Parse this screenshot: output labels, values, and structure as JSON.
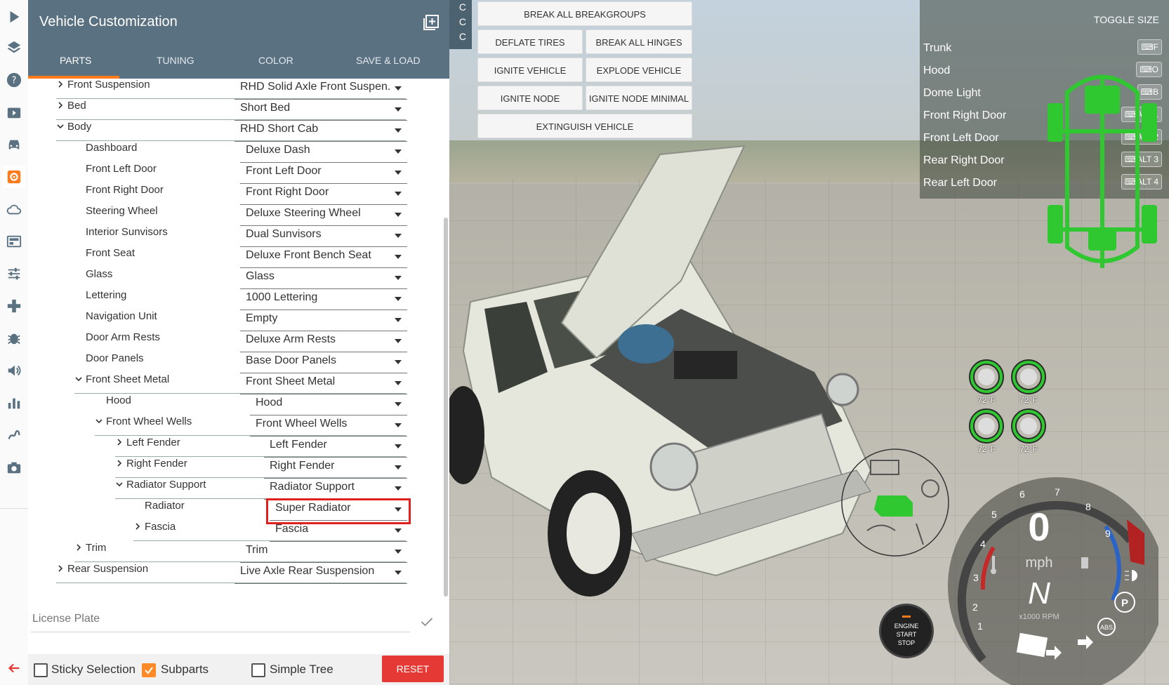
{
  "panel": {
    "title": "Vehicle Customization",
    "tabs": [
      "PARTS",
      "TUNING",
      "COLOR",
      "SAVE & LOAD"
    ],
    "active_tab": "PARTS",
    "tree": [
      {
        "label": "Front Suspension",
        "value": "RHD Solid Axle Front Suspen...",
        "depth": 0,
        "expander": "collapsed"
      },
      {
        "label": "Bed",
        "value": "Short Bed",
        "depth": 0,
        "expander": "collapsed"
      },
      {
        "label": "Body",
        "value": "RHD Short Cab",
        "depth": 0,
        "expander": "expanded"
      },
      {
        "label": "Dashboard",
        "value": "Deluxe Dash",
        "depth": 1,
        "expander": "none"
      },
      {
        "label": "Front Left Door",
        "value": "Front Left Door",
        "depth": 1,
        "expander": "none"
      },
      {
        "label": "Front Right Door",
        "value": "Front Right Door",
        "depth": 1,
        "expander": "none"
      },
      {
        "label": "Steering Wheel",
        "value": "Deluxe Steering Wheel",
        "depth": 1,
        "expander": "none"
      },
      {
        "label": "Interior Sunvisors",
        "value": "Dual Sunvisors",
        "depth": 1,
        "expander": "none"
      },
      {
        "label": "Front Seat",
        "value": "Deluxe Front Bench Seat",
        "depth": 1,
        "expander": "none"
      },
      {
        "label": "Glass",
        "value": "Glass",
        "depth": 1,
        "expander": "none"
      },
      {
        "label": "Lettering",
        "value": "1000 Lettering",
        "depth": 1,
        "expander": "none"
      },
      {
        "label": "Navigation Unit",
        "value": "Empty",
        "depth": 1,
        "expander": "none"
      },
      {
        "label": "Door Arm Rests",
        "value": "Deluxe Arm Rests",
        "depth": 1,
        "expander": "none"
      },
      {
        "label": "Door Panels",
        "value": "Base Door Panels",
        "depth": 1,
        "expander": "none"
      },
      {
        "label": "Front Sheet Metal",
        "value": "Front Sheet Metal",
        "depth": 1,
        "expander": "expanded"
      },
      {
        "label": "Hood",
        "value": "Hood",
        "depth": 2,
        "expander": "none"
      },
      {
        "label": "Front Wheel Wells",
        "value": "Front Wheel Wells",
        "depth": 2,
        "expander": "expanded"
      },
      {
        "label": "Left Fender",
        "value": "Left Fender",
        "depth": 3,
        "expander": "collapsed"
      },
      {
        "label": "Right Fender",
        "value": "Right Fender",
        "depth": 3,
        "expander": "collapsed"
      },
      {
        "label": "Radiator Support",
        "value": "Radiator Support",
        "depth": 3,
        "expander": "expanded"
      },
      {
        "label": "Radiator",
        "value": "Super Radiator",
        "depth": 4,
        "expander": "none",
        "highlighted": true
      },
      {
        "label": "Fascia",
        "value": "Fascia",
        "depth": 4,
        "expander": "collapsed"
      },
      {
        "label": "Trim",
        "value": "Trim",
        "depth": 1,
        "expander": "collapsed"
      },
      {
        "label": "Rear Suspension",
        "value": "Live Axle Rear Suspension",
        "depth": 0,
        "expander": "collapsed"
      }
    ],
    "license_placeholder": "License Plate",
    "footer": {
      "sticky_selection": {
        "label": "Sticky Selection",
        "checked": false
      },
      "subparts": {
        "label": "Subparts",
        "checked": true
      },
      "simple_tree": {
        "label": "Simple Tree",
        "checked": false
      },
      "reset_label": "RESET"
    }
  },
  "rail_icons": [
    "play-icon",
    "layers-icon",
    "help-icon",
    "video-icon",
    "car-icon",
    "gear-icon",
    "cloud-icon",
    "dashboard-icon",
    "sliders-icon",
    "gamepad-icon",
    "bug-icon",
    "volume-icon",
    "bar-chart-icon",
    "path-icon",
    "camera-icon"
  ],
  "rail_back_icon": "back-arrow-icon",
  "ccc_labels": [
    "C",
    "C",
    "C"
  ],
  "cheat_buttons": {
    "break_all_breakgroups": "BREAK ALL BREAKGROUPS",
    "deflate_tires": "DEFLATE TIRES",
    "break_all_hinges": "BREAK ALL HINGES",
    "ignite_vehicle": "IGNITE VEHICLE",
    "explode_vehicle": "EXPLODE VEHICLE",
    "ignite_node": "IGNITE NODE",
    "ignite_node_minimal": "IGNITE NODE MINIMAL",
    "extinguish_vehicle": "EXTINGUISH VEHICLE"
  },
  "lights_panel": {
    "toggle_size": "TOGGLE SIZE",
    "items": [
      {
        "name": "Trunk",
        "key": "⌨F"
      },
      {
        "name": "Hood",
        "key": "⌨O"
      },
      {
        "name": "Dome Light",
        "key": "⌨B"
      },
      {
        "name": "Front Right Door",
        "key": "⌨ALT 1"
      },
      {
        "name": "Front Left Door",
        "key": "⌨ALT 2"
      },
      {
        "name": "Rear Right Door",
        "key": "⌨ALT 3"
      },
      {
        "name": "Rear Left Door",
        "key": "⌨ALT 4"
      }
    ]
  },
  "tires": [
    "72°F",
    "72°F",
    "72°F",
    "72°F"
  ],
  "engine_button": {
    "line1": "ENGINE",
    "line2": "START",
    "line3": "STOP"
  },
  "gauge": {
    "speed": "0",
    "speed_unit": "mph",
    "gear": "N",
    "rpm_unit": "x1000 RPM",
    "rpm_ticks": [
      "1",
      "2",
      "3",
      "4",
      "5",
      "6",
      "7",
      "8",
      "9"
    ],
    "parking": "P",
    "abs": "ABS"
  },
  "colors": {
    "header": "#5a7181",
    "accent": "#ff7a1a",
    "reset": "#e53935",
    "highlight": "#e0201c",
    "hud_green": "#2fc830"
  }
}
